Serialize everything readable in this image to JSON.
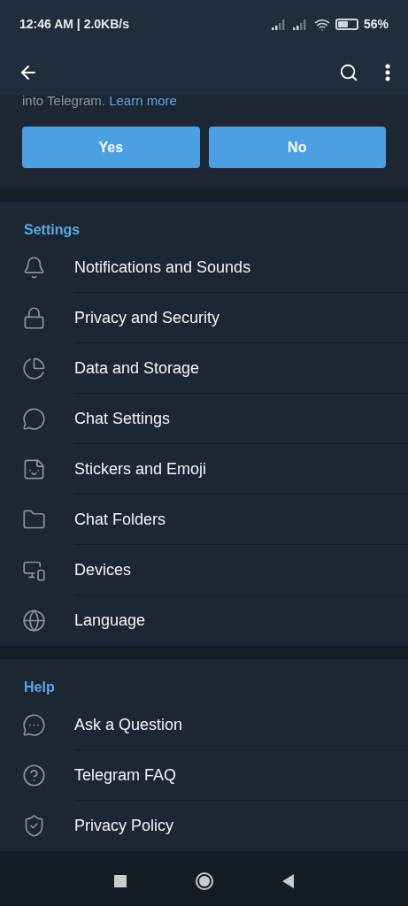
{
  "status_bar": {
    "time": "12:46 AM | 2.0KB/s",
    "battery": "56%"
  },
  "notice": {
    "text": "into Telegram.",
    "link": "Learn more"
  },
  "buttons": [
    "Yes",
    "No"
  ],
  "sections": [
    {
      "title": "Settings",
      "items": [
        "Notifications and Sounds",
        "Privacy and Security",
        "Data and Storage",
        "Chat Settings",
        "Stickers and Emoji",
        "Chat Folders",
        "Devices",
        "Language"
      ]
    },
    {
      "title": "Help",
      "items": [
        "Ask a Question",
        "Telegram FAQ",
        "Privacy Policy"
      ]
    }
  ]
}
